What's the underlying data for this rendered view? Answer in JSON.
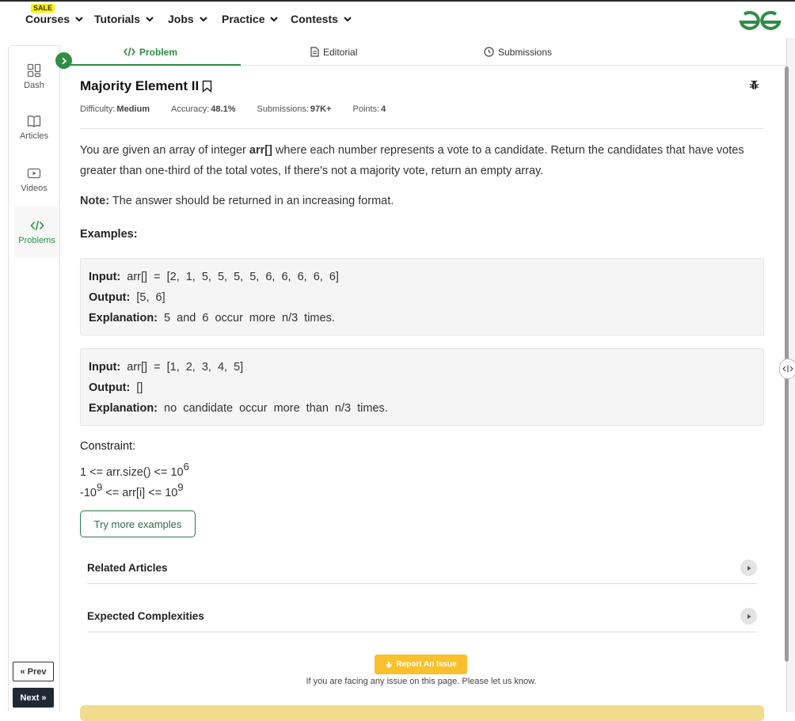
{
  "nav": {
    "sale_badge": "SALE",
    "items": [
      {
        "label": "Courses"
      },
      {
        "label": "Tutorials"
      },
      {
        "label": "Jobs"
      },
      {
        "label": "Practice"
      },
      {
        "label": "Contests"
      }
    ],
    "logo_icon": "gfg-logo-icon",
    "brand_color": "#2f8d46"
  },
  "sidebar": {
    "items": [
      {
        "label": "Dash",
        "icon": "dashboard-icon"
      },
      {
        "label": "Articles",
        "icon": "book-icon"
      },
      {
        "label": "Videos",
        "icon": "play-icon"
      },
      {
        "label": "Problems",
        "icon": "code-icon",
        "active": true
      }
    ],
    "prev_label": "Prev",
    "next_label": "Next"
  },
  "tabs": [
    {
      "label": "Problem",
      "icon": "code-icon",
      "active": true
    },
    {
      "label": "Editorial",
      "icon": "document-icon"
    },
    {
      "label": "Submissions",
      "icon": "clock-icon"
    }
  ],
  "problem": {
    "title": "Majority Element II",
    "meta": {
      "difficulty_label": "Difficulty:",
      "difficulty": "Medium",
      "accuracy_label": "Accuracy:",
      "accuracy": "48.1%",
      "submissions_label": "Submissions:",
      "submissions": "97K+",
      "points_label": "Points:",
      "points": "4"
    },
    "desc_1": "You are given an array of integer ",
    "desc_bold": "arr[]",
    "desc_2": " where each number represents a vote to a candidate. Return the candidates that have votes greater than one-third of the total votes, If there's not a majority vote, return an empty array.",
    "note_label": "Note:",
    "note_text": " The answer should be returned in an increasing format.",
    "examples_heading": "Examples:",
    "examples": [
      {
        "input_label": "Input:",
        "input": " arr[] = [2, 1, 5, 5, 5, 5, 6, 6, 6, 6, 6]",
        "output_label": "Output:",
        "output": " [5, 6]",
        "explanation_label": "Explanation:",
        "explanation": " 5 and 6 occur more n/3 times."
      },
      {
        "input_label": "Input:",
        "input": " arr[] = [1, 2, 3, 4, 5]",
        "output_label": "Output:",
        "output": " []",
        "explanation_label": "Explanation:",
        "explanation": " no candidate occur more than n/3 times."
      }
    ],
    "constraint_heading": "Constraint:",
    "constraint_1_pre": "1 <= arr.size() <= 10",
    "constraint_1_sup": "6",
    "constraint_2_a": "-10",
    "constraint_2_sup_a": "9",
    "constraint_2_b": " <= arr[i] <= 10",
    "constraint_2_sup_b": "9",
    "try_more": "Try more examples"
  },
  "accordions": [
    {
      "label": "Related Articles"
    },
    {
      "label": "Expected Complexities"
    }
  ],
  "report": {
    "button": "Report An Issue",
    "text": "If you are facing any issue on this page. Please let us know."
  }
}
